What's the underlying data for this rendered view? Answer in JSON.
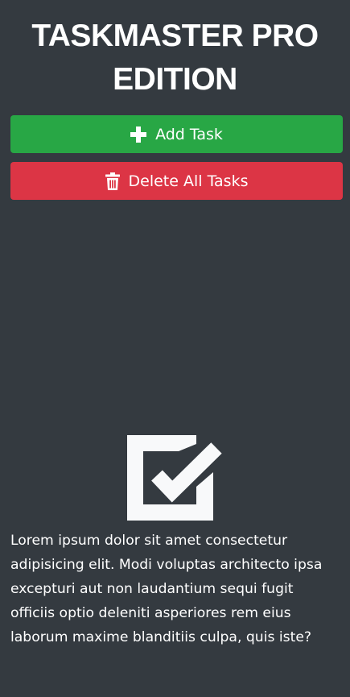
{
  "app": {
    "title": "TASKMASTER PRO EDITION"
  },
  "toolbar": {
    "add_label": "Add Task",
    "add_icon": "plus-icon",
    "add_color": "#28a745",
    "delete_label": "Delete All Tasks",
    "delete_icon": "trash-icon",
    "delete_color": "#dc3545"
  },
  "empty_state": {
    "icon": "checkbox-check-icon",
    "text": "Lorem ipsum dolor sit amet consectetur adipisicing elit. Modi voluptas architecto ipsa excepturi aut non laudantium sequi fugit officiis optio deleniti asperiores rem eius laborum maxime blanditiis culpa, quis iste?"
  },
  "theme": {
    "background": "#343a40",
    "text": "#ffffff",
    "icon": "#f8f9fa"
  }
}
